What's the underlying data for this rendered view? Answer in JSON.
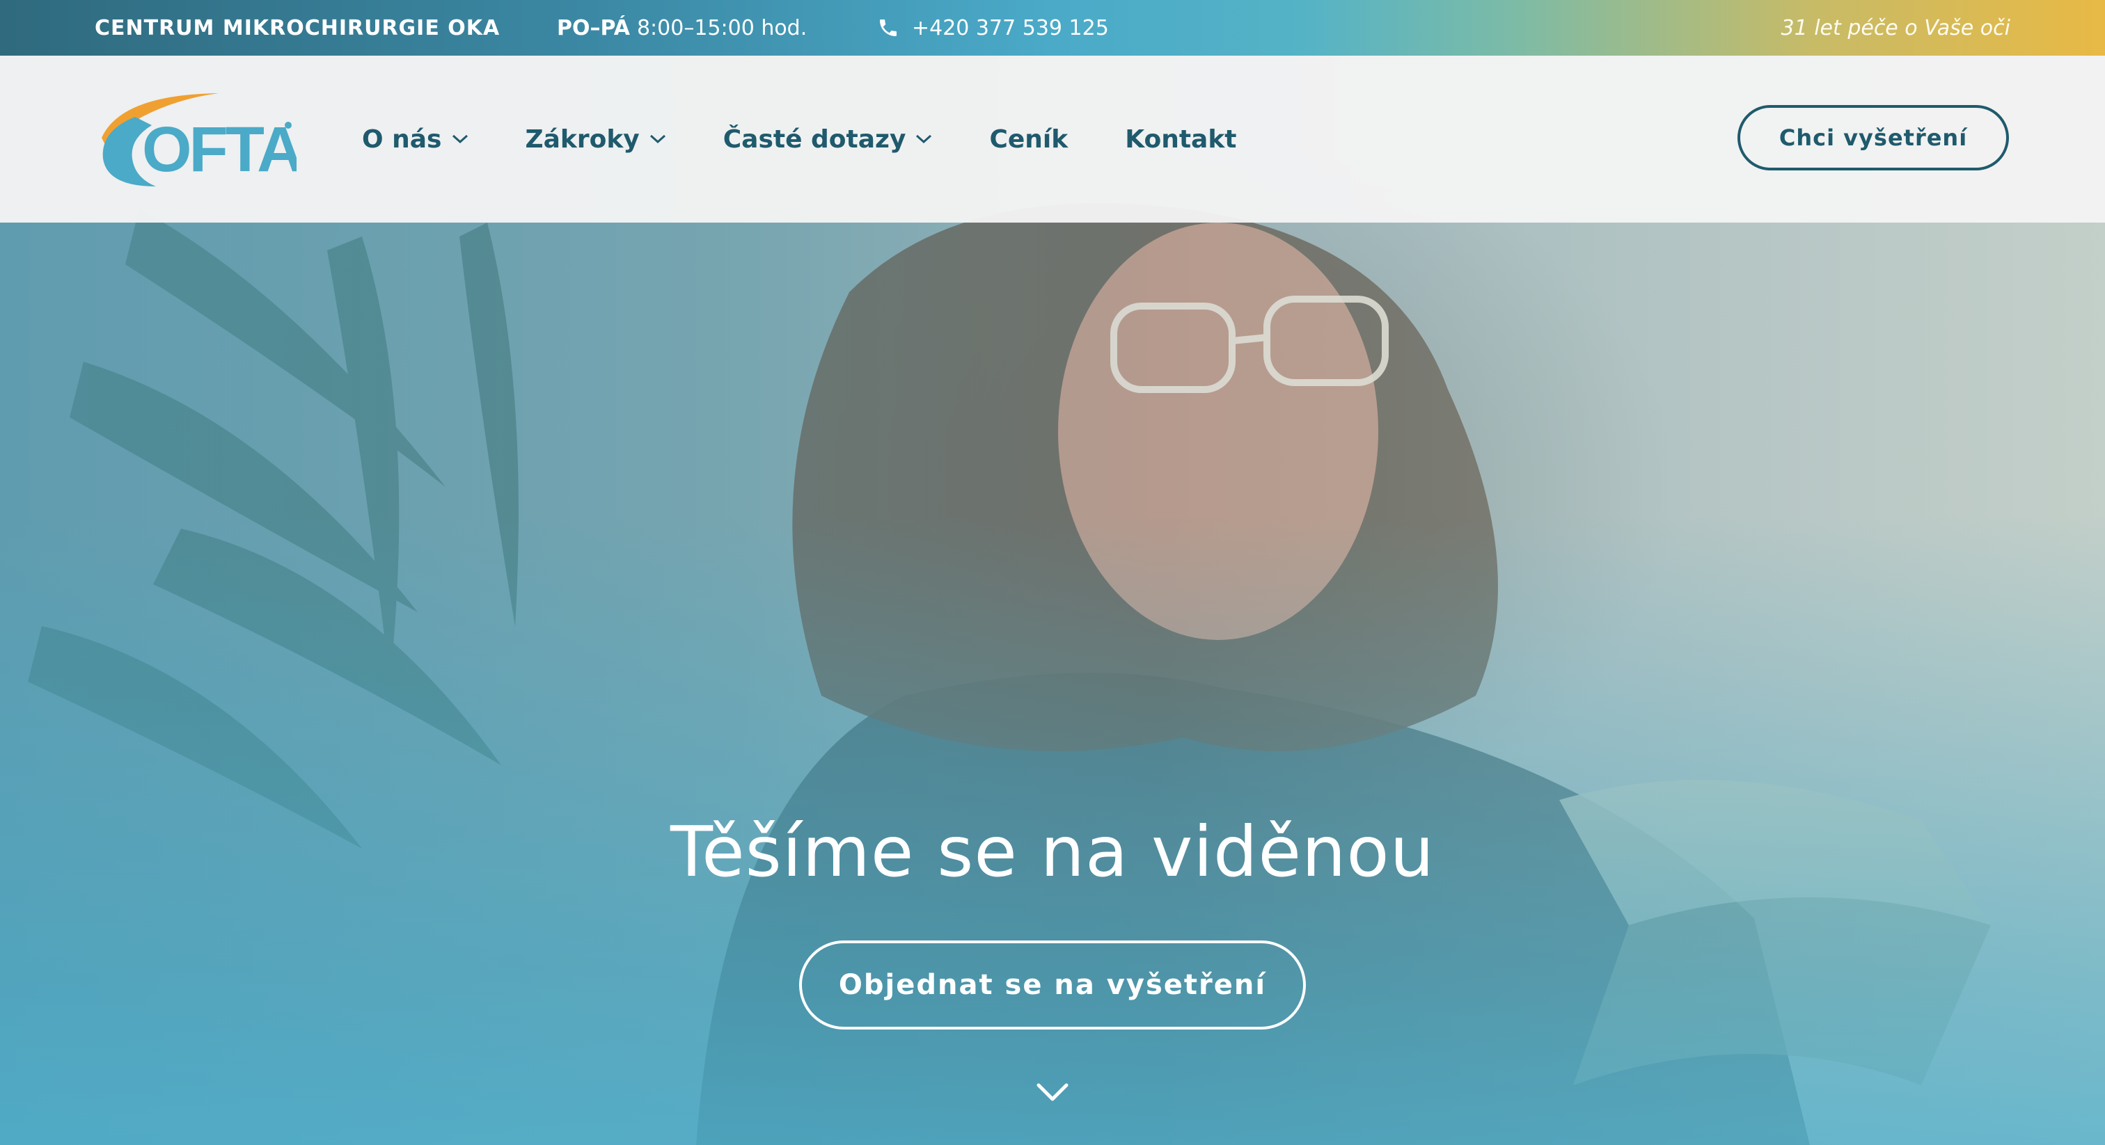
{
  "topbar": {
    "center_name": "CENTRUM MIKROCHIRURGIE OKA",
    "hours_days": "PO–PÁ",
    "hours_time": "8:00–15:00 hod.",
    "phone": "+420 377 539 125",
    "tagline": "31 let péče o Vaše oči",
    "icons": {
      "phone": "phone-icon"
    }
  },
  "header": {
    "logo_text": "OFTA",
    "nav": [
      {
        "label": "O nás",
        "has_dropdown": true
      },
      {
        "label": "Zákroky",
        "has_dropdown": true
      },
      {
        "label": "Časté dotazy",
        "has_dropdown": true
      },
      {
        "label": "Ceník",
        "has_dropdown": false
      },
      {
        "label": "Kontakt",
        "has_dropdown": false
      }
    ],
    "cta_label": "Chci vyšetření"
  },
  "hero": {
    "title": "Těšíme se na viděnou",
    "button_label": "Objednat se na vyšetření",
    "scroll_icon": "chevron-down-icon"
  },
  "colors": {
    "brand_dark": "#1f5a6d",
    "brand_blue": "#4aaac8",
    "brand_gold": "#e8b945",
    "logo_orange": "#f0a030"
  }
}
